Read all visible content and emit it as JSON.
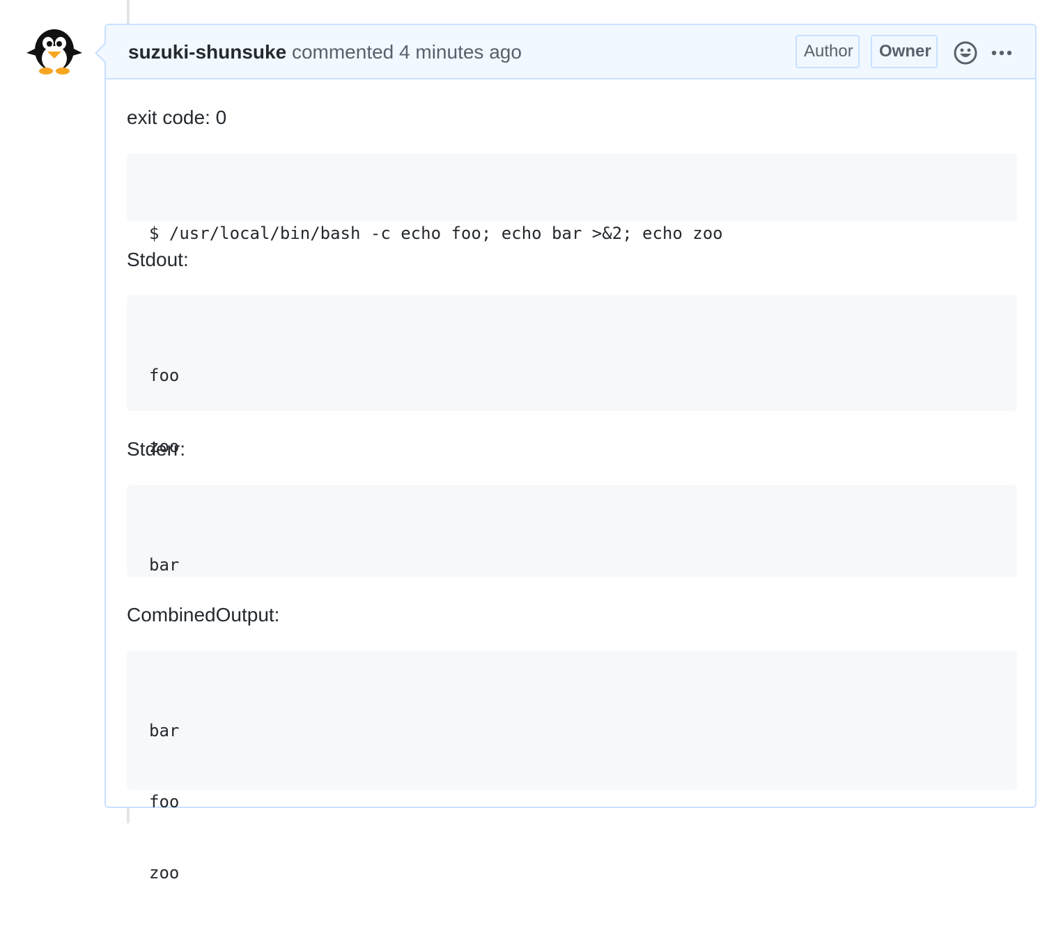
{
  "comment": {
    "author": "suzuki-shunsuke",
    "action": "commented",
    "time": "4 minutes ago",
    "badges": {
      "author": "Author",
      "owner": "Owner"
    },
    "icons": {
      "avatar": "penguin-avatar",
      "reaction": "smiley-icon",
      "more": "kebab-horizontal-icon"
    }
  },
  "body": {
    "exit_code_text": "exit code: 0",
    "command": "$ /usr/local/bin/bash -c echo foo; echo bar >&2; echo zoo",
    "stdout_label": "Stdout:",
    "stdout_lines": [
      "foo",
      "zoo"
    ],
    "stderr_label": "Stderr:",
    "stderr_lines": [
      "bar"
    ],
    "combined_label": "CombinedOutput:",
    "combined_lines": [
      "bar",
      "foo",
      "zoo"
    ]
  },
  "colors": {
    "header_bg": "#f1f8ff",
    "border": "#c8e1ff",
    "code_bg": "#f6f8fa",
    "text": "#24292e",
    "muted": "#586069"
  }
}
